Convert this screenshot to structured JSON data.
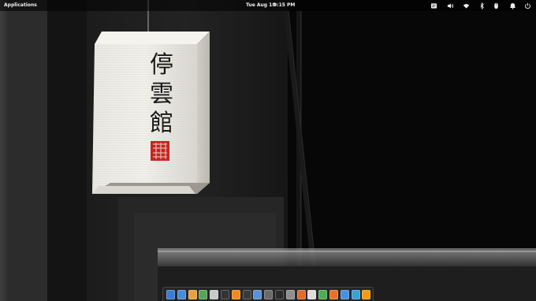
{
  "panel": {
    "applications_label": "Applications",
    "date": "Tue Aug 18",
    "time": "9:15 PM",
    "indicators": [
      "text-editor-icon",
      "volume-icon",
      "wifi-icon",
      "bluetooth-icon",
      "mouse-icon",
      "notifications-icon",
      "power-icon"
    ]
  },
  "wallpaper": {
    "lantern_text": [
      "停",
      "雲",
      "館"
    ],
    "seal": "red-seal-stamp"
  },
  "dock": {
    "apps": [
      {
        "name": "multitasking-view-icon",
        "color": "#3a7bd5"
      },
      {
        "name": "workspace-switcher-icon",
        "color": "#4b8bd8"
      },
      {
        "name": "mail-icon",
        "color": "#e7a23d"
      },
      {
        "name": "calendar-icon",
        "color": "#5aa35a"
      },
      {
        "name": "files-icon",
        "color": "#c9c9c9"
      },
      {
        "name": "music-icon",
        "color": "#333333"
      },
      {
        "name": "vlc-icon",
        "color": "#f08a1c"
      },
      {
        "name": "terminal-icon",
        "color": "#3a3a3a"
      },
      {
        "name": "folder-icon",
        "color": "#5b8fd6"
      },
      {
        "name": "image-viewer-icon",
        "color": "#6a6a6a"
      },
      {
        "name": "console-icon",
        "color": "#2b2b2b"
      },
      {
        "name": "app-center-icon",
        "color": "#8e8e8e"
      },
      {
        "name": "store-icon",
        "color": "#e06b2a"
      },
      {
        "name": "text-editor-icon",
        "color": "#dcdcdc"
      },
      {
        "name": "photos-icon",
        "color": "#4caf50"
      },
      {
        "name": "firefox-icon",
        "color": "#e8722c"
      },
      {
        "name": "chromium-icon",
        "color": "#4a90e2"
      },
      {
        "name": "fontforge-icon",
        "color": "#3aa0d8"
      },
      {
        "name": "vlc-player-icon",
        "color": "#f39c12"
      }
    ]
  }
}
